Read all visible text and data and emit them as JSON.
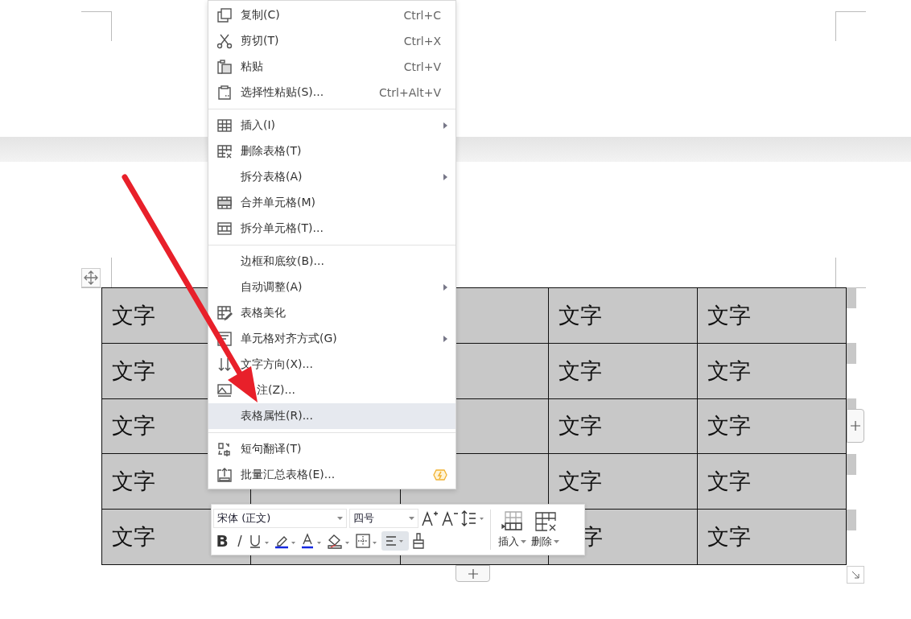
{
  "menu": {
    "sections": [
      [
        {
          "label": "复制(C)",
          "shortcut": "Ctrl+C",
          "submenu": false,
          "selected": false
        },
        {
          "label": "剪切(T)",
          "shortcut": "Ctrl+X",
          "submenu": false,
          "selected": false
        },
        {
          "label": "粘贴",
          "shortcut": "Ctrl+V",
          "submenu": false,
          "selected": false
        },
        {
          "label": "选择性粘贴(S)...",
          "shortcut": "Ctrl+Alt+V",
          "submenu": false,
          "selected": false
        }
      ],
      [
        {
          "label": "插入(I)",
          "submenu": true,
          "selected": false
        },
        {
          "label": "删除表格(T)",
          "submenu": false,
          "selected": false
        },
        {
          "label": "拆分表格(A)",
          "submenu": true,
          "selected": false
        },
        {
          "label": "合并单元格(M)",
          "submenu": false,
          "selected": false
        },
        {
          "label": "拆分单元格(T)...",
          "submenu": false,
          "selected": false
        }
      ],
      [
        {
          "label": "边框和底纹(B)...",
          "submenu": false,
          "selected": false
        },
        {
          "label": "自动调整(A)",
          "submenu": true,
          "selected": false
        },
        {
          "label": "表格美化",
          "submenu": false,
          "selected": false
        },
        {
          "label": "单元格对齐方式(G)",
          "submenu": true,
          "selected": false
        },
        {
          "label": "文字方向(X)...",
          "submenu": false,
          "selected": false
        },
        {
          "label": "注(Z)...",
          "submenu": false,
          "selected": false
        },
        {
          "label": "表格属性(R)...",
          "submenu": false,
          "selected": true
        }
      ],
      [
        {
          "label": "短句翻译(T)",
          "submenu": false,
          "selected": false
        },
        {
          "label": "批量汇总表格(E)...",
          "submenu": false,
          "selected": false
        }
      ]
    ]
  },
  "toolbar": {
    "bold": "B",
    "font": "宋体 (正文)",
    "size": "四号",
    "align_selected": true,
    "actions": [
      {
        "label": "插入"
      },
      {
        "label": "删除"
      }
    ]
  },
  "table": {
    "rows": [
      [
        "文字",
        null,
        null,
        "文字",
        "文字"
      ],
      [
        "文字",
        null,
        null,
        "文字",
        "文字"
      ],
      [
        "文字",
        null,
        null,
        "文字",
        "文字"
      ],
      [
        "文字",
        null,
        null,
        "文字",
        "文字"
      ],
      [
        "文字",
        null,
        null,
        "字",
        "文字"
      ]
    ]
  }
}
